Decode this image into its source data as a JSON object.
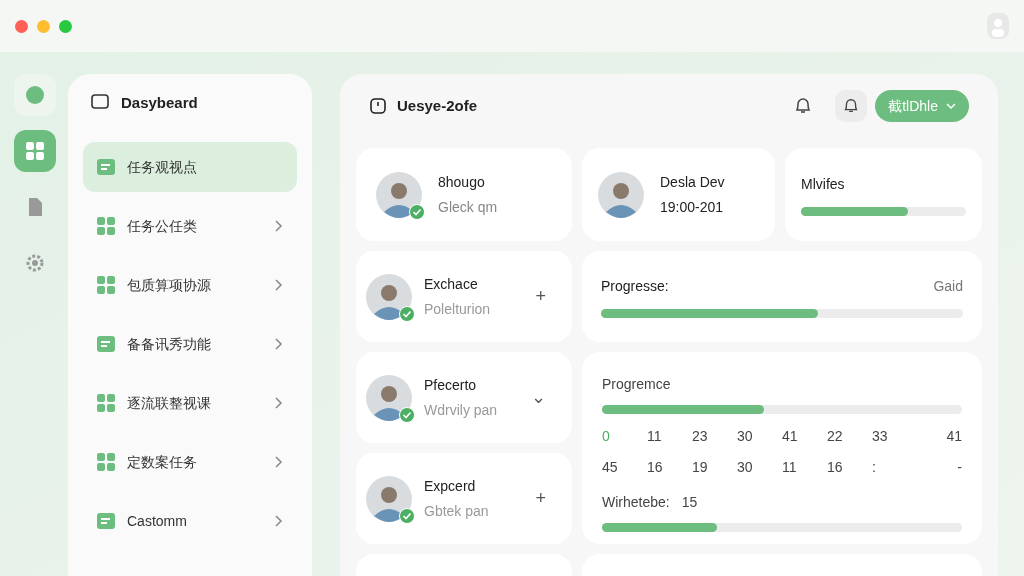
{
  "rail": [
    {
      "selected": false
    },
    {
      "selected": true
    },
    {
      "selected": false
    },
    {
      "selected": false
    }
  ],
  "sidebar": {
    "title": "Dasybeard",
    "items": [
      {
        "label": "任务观视点",
        "selected": true,
        "chevron": false
      },
      {
        "label": "任务公任类",
        "selected": false,
        "chevron": true
      },
      {
        "label": "包质算项协源",
        "selected": false,
        "chevron": true
      },
      {
        "label": "备备讯秀功能",
        "selected": false,
        "chevron": true
      },
      {
        "label": "逐流联整视课",
        "selected": false,
        "chevron": true
      },
      {
        "label": "定数案任务",
        "selected": false,
        "chevron": true
      },
      {
        "label": "Castomm",
        "selected": false,
        "chevron": true
      }
    ]
  },
  "header": {
    "title": "Uesye-2ofe",
    "button": "截tlDhle"
  },
  "people": [
    {
      "name": "Exchace",
      "subtitle": "Polelturion",
      "action": "+"
    },
    {
      "name": "Pfecerto",
      "subtitle": "Wdrvily pan",
      "action": "⌄"
    },
    {
      "name": "Expcerd",
      "subtitle": "Gbtek pan",
      "action": "+"
    }
  ],
  "top_cards": [
    {
      "kind": "person",
      "name": "8hougo",
      "subtitle": "Gleck qm",
      "verified": true
    },
    {
      "kind": "person",
      "name": "Desla Dev",
      "subtitle": "19:00-201",
      "verified": false
    },
    {
      "kind": "meter",
      "name": "Mlvifes",
      "level": 0.65
    }
  ],
  "progress": {
    "label": "Progresse:",
    "reading": "Gaid",
    "level": 0.6
  },
  "progress2": {
    "label": "Progremce",
    "level": 0.45,
    "rows": [
      [
        {
          "value": "0",
          "highlighted": true
        },
        {
          "value": "11",
          "highlighted": false
        },
        {
          "value": "23",
          "highlighted": false
        },
        {
          "value": "30",
          "highlighted": false
        },
        {
          "value": "41",
          "highlighted": false
        },
        {
          "value": "22",
          "highlighted": false
        },
        {
          "value": "33",
          "highlighted": false
        },
        {
          "value": "41",
          "highlighted": false
        }
      ],
      [
        {
          "value": "45",
          "highlighted": false
        },
        {
          "value": "16",
          "highlighted": false
        },
        {
          "value": "19",
          "highlighted": false
        },
        {
          "value": "30",
          "highlighted": false
        },
        {
          "value": "11",
          "highlighted": false
        },
        {
          "value": "16",
          "highlighted": false
        },
        {
          "value": ":",
          "highlighted": false
        },
        {
          "value": "-",
          "highlighted": false
        }
      ]
    ],
    "footer": {
      "label": "Wirhetebe:",
      "value": "15",
      "level": 0.32
    }
  }
}
